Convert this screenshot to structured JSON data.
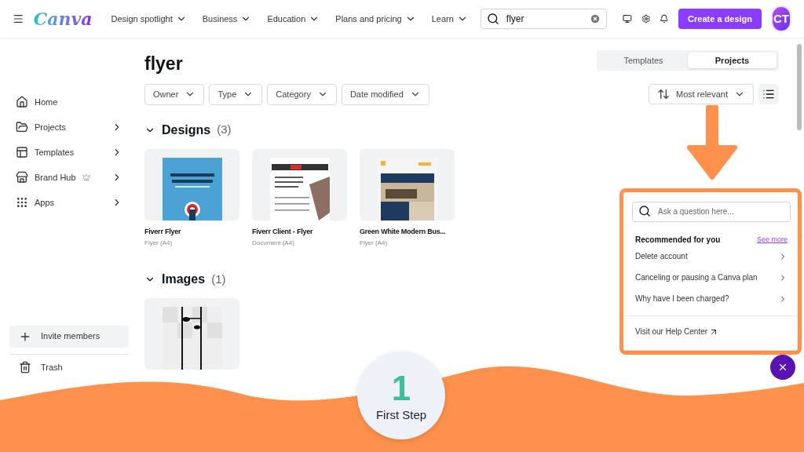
{
  "topbar": {
    "logo": "Canva",
    "nav": [
      {
        "label": "Design spotlight"
      },
      {
        "label": "Business"
      },
      {
        "label": "Education"
      },
      {
        "label": "Plans and pricing"
      },
      {
        "label": "Learn"
      }
    ],
    "search": {
      "value": "flyer"
    },
    "create_button": "Create a design",
    "avatar": "CT"
  },
  "sidebar": {
    "items": [
      {
        "label": "Home",
        "kind": "home",
        "has_submenu": false,
        "premium": false
      },
      {
        "label": "Projects",
        "kind": "projects",
        "has_submenu": true,
        "premium": false
      },
      {
        "label": "Templates",
        "kind": "templates",
        "has_submenu": true,
        "premium": false
      },
      {
        "label": "Brand Hub",
        "kind": "brand",
        "has_submenu": true,
        "premium": true
      },
      {
        "label": "Apps",
        "kind": "apps",
        "has_submenu": true,
        "premium": false
      }
    ],
    "invite": "Invite members",
    "trash": "Trash"
  },
  "main": {
    "title": "flyer",
    "filters": [
      "Owner",
      "Type",
      "Category",
      "Date modified"
    ],
    "view_tabs": [
      {
        "label": "Templates",
        "selected": false
      },
      {
        "label": "Projects",
        "selected": true
      }
    ],
    "sort": "Most relevant",
    "sections": [
      {
        "title": "Designs",
        "count": "(3)",
        "expanded": true,
        "items": [
          {
            "kind": "picture",
            "title": "Fiverr Flyer",
            "subtitle": "Flyer (A4)"
          },
          {
            "kind": "picture",
            "title": "Fiverr Client - Flyer",
            "subtitle": "Document (A4)"
          },
          {
            "kind": "picture",
            "title": "Green White Modern Bus...",
            "subtitle": "Flyer (A4)"
          }
        ]
      },
      {
        "title": "Images",
        "count": "(1)",
        "expanded": true
      }
    ]
  },
  "help": {
    "placeholder": "Ask a question here...",
    "heading": "Recommended for you",
    "link": "See more",
    "articles": [
      "Delete account",
      "Canceling or pausing a Canva plan",
      "Why have I been charged?"
    ],
    "footer": "Visit our Help Center"
  },
  "step": {
    "number": "1",
    "label": "First Step"
  }
}
